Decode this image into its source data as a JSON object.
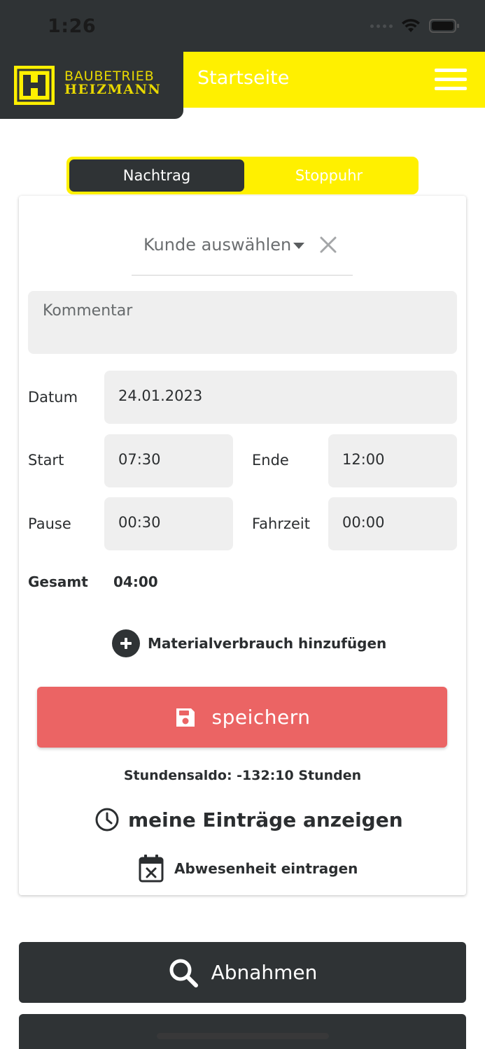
{
  "status_bar": {
    "time": "1:26"
  },
  "header": {
    "logo_line1": "BAUBETRIEB",
    "logo_line2": "HEIZMANN",
    "title": "Startseite"
  },
  "segment": {
    "tab_active": "Nachtrag",
    "tab_inactive": "Stoppuhr"
  },
  "form": {
    "customer_placeholder": "Kunde auswählen",
    "comment_placeholder": "Kommentar",
    "date_label": "Datum",
    "date_value": "24.01.2023",
    "start_label": "Start",
    "start_value": "07:30",
    "end_label": "Ende",
    "end_value": "12:00",
    "break_label": "Pause",
    "break_value": "00:30",
    "travel_label": "Fahrzeit",
    "travel_value": "00:00",
    "total_label": "Gesamt",
    "total_value": "04:00",
    "material_label": "Materialverbrauch hinzufügen",
    "save_label": "speichern",
    "saldo_text": "Stundensaldo: -132:10 Stunden",
    "entries_label": "meine Einträge anzeigen",
    "absence_label": "Abwesenheit eintragen"
  },
  "actions": {
    "abnahmen_label": "Abnahmen"
  },
  "colors": {
    "brand_yellow": "#fff000",
    "dark": "#2f3335",
    "save_red": "#eb6464"
  }
}
